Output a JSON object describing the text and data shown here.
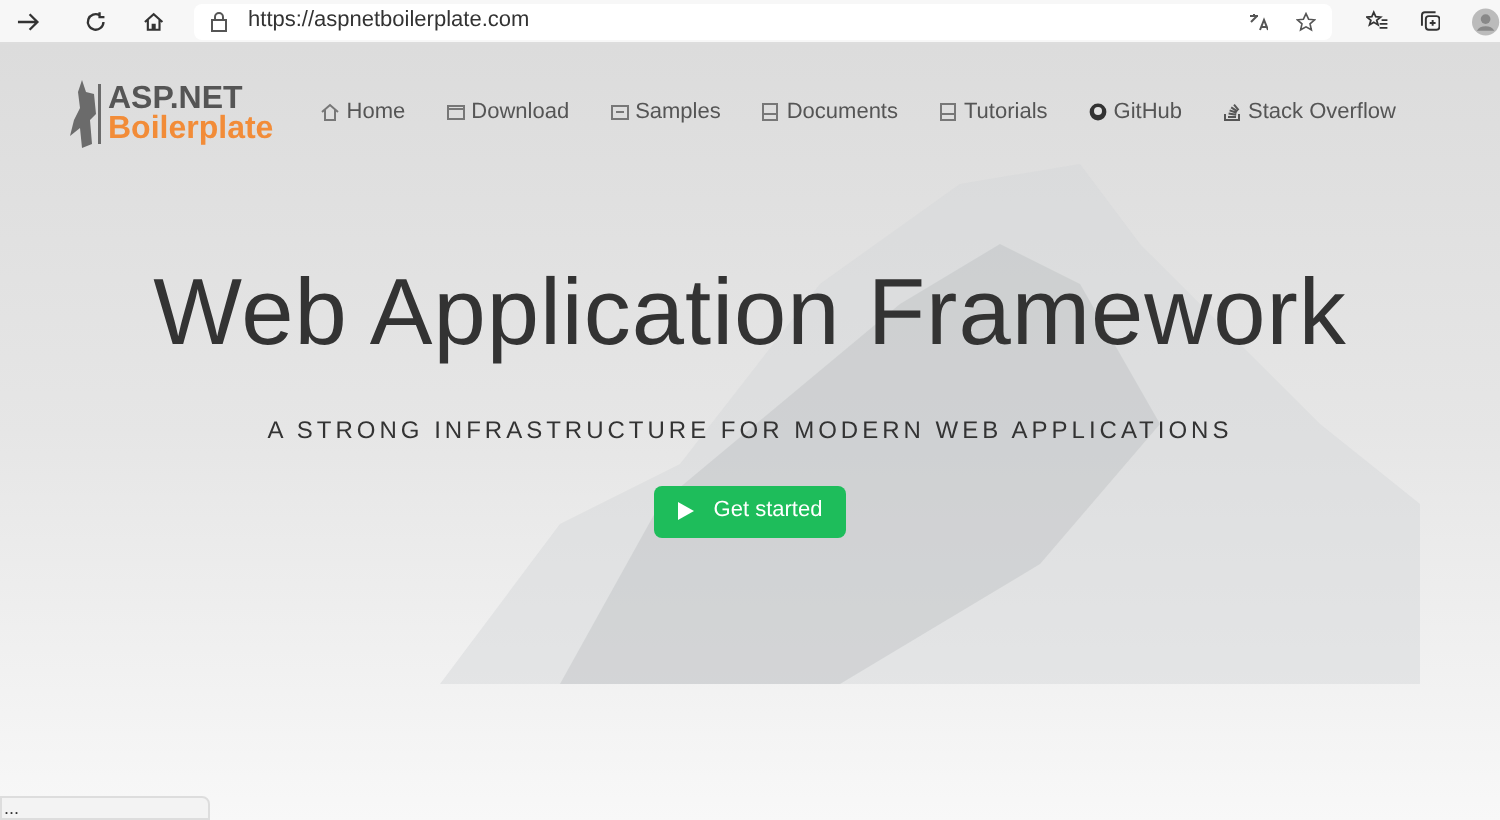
{
  "browser": {
    "url": "https://aspnetboilerplate.com"
  },
  "logo": {
    "line_1": "ASP.NET",
    "line_2": "Boilerplate"
  },
  "nav": [
    {
      "label": "Home",
      "kind": "home"
    },
    {
      "label": "Download",
      "kind": "download"
    },
    {
      "label": "Samples",
      "kind": "samples"
    },
    {
      "label": "Documents",
      "kind": "doc"
    },
    {
      "label": "Tutorials",
      "kind": "doc"
    },
    {
      "label": "GitHub",
      "kind": "github"
    },
    {
      "label": "Stack Overflow",
      "kind": "stack"
    }
  ],
  "hero": {
    "title": "Web Application Framework",
    "subtitle": "A STRONG INFRASTRUCTURE FOR MODERN WEB APPLICATIONS",
    "button": "Get started"
  },
  "status_bar": {
    "text": "..."
  }
}
